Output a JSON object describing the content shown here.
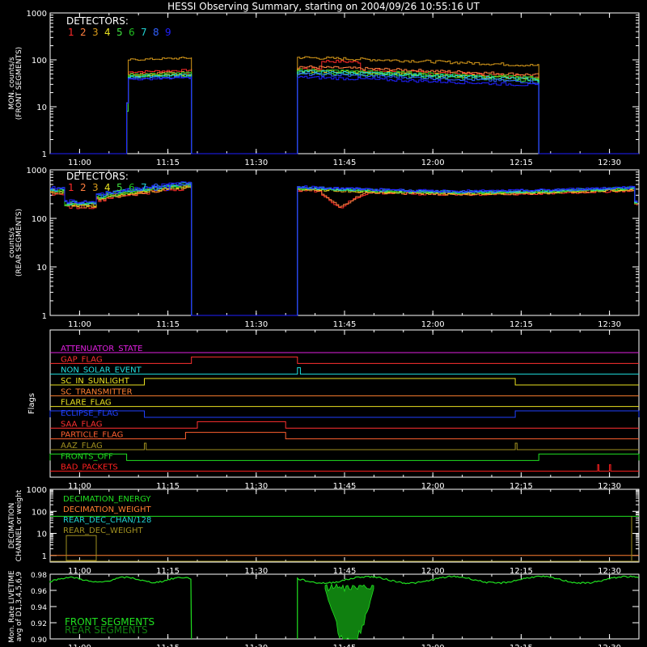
{
  "title": "HESSI Observing Summary, starting on 2004/09/26 10:55:16 UT",
  "colors": {
    "frame": "#ffffff",
    "detectors": [
      "#ff2a2a",
      "#ff7f3f",
      "#d89a1a",
      "#e8e020",
      "#40e040",
      "#20c020",
      "#20d0d0",
      "#3060ff",
      "#2020ff"
    ]
  },
  "chart_data": [
    {
      "type": "line",
      "panel": "front_rates",
      "ylabel_lines": [
        "MON. counts/s",
        "(FRONT SEGMENTS)"
      ],
      "y_log": true,
      "ylim": [
        1,
        1000
      ],
      "y_ticks": [
        "1",
        "10",
        "100",
        "1000"
      ],
      "x_ticks": [
        "11:00",
        "11:15",
        "11:30",
        "11:45",
        "12:00",
        "12:15",
        "12:30"
      ],
      "xlim_minutes_after_10:55": [
        0,
        100
      ],
      "legend_title": "DETECTORS:",
      "legend_items": [
        "1",
        "2",
        "3",
        "4",
        "5",
        "6",
        "7",
        "8",
        "9"
      ],
      "data_segments": [
        {
          "start": "11:08",
          "end": "11:19",
          "level_range": [
            40,
            110
          ]
        },
        {
          "start": "11:37",
          "end": "12:18",
          "level_range": [
            25,
            120
          ]
        }
      ]
    },
    {
      "type": "line",
      "panel": "rear_rates",
      "ylabel_lines": [
        "counts/s",
        "(REAR SEGMENTS)"
      ],
      "y_log": true,
      "ylim": [
        1,
        1000
      ],
      "y_ticks": [
        "1",
        "10",
        "100",
        "1000"
      ],
      "x_ticks": [
        "11:00",
        "11:15",
        "11:30",
        "11:45",
        "12:00",
        "12:15",
        "12:30"
      ],
      "legend_title": "DETECTORS:",
      "legend_items": [
        "1",
        "2",
        "3",
        "4",
        "5",
        "6",
        "7",
        "8",
        "9"
      ],
      "data_segments": [
        {
          "start": "10:55",
          "end": "11:19",
          "level_range": [
            180,
            600
          ]
        },
        {
          "start": "11:37",
          "end": "12:35",
          "level_range": [
            150,
            450
          ]
        }
      ]
    },
    {
      "type": "table",
      "panel": "flags",
      "ylabel": "Flags",
      "x_ticks": [
        "11:00",
        "11:15",
        "11:30",
        "11:45",
        "12:00",
        "12:15",
        "12:30"
      ],
      "flags": [
        {
          "label": "ATTENUATOR_STATE",
          "color": "#e020e0",
          "on_intervals": []
        },
        {
          "label": "GAP_FLAG",
          "color": "#ff3030",
          "on_intervals": [
            [
              "11:19",
              "11:37"
            ]
          ]
        },
        {
          "label": "NON_SOLAR_EVENT",
          "color": "#20e0e0",
          "on_intervals": [
            [
              "11:37",
              "11:37.5"
            ]
          ]
        },
        {
          "label": "SC_IN_SUNLIGHT",
          "color": "#e8e020",
          "on_intervals": [
            [
              "11:11",
              "12:14"
            ]
          ]
        },
        {
          "label": "SC_TRANSMITTER",
          "color": "#ff8030",
          "on_intervals": []
        },
        {
          "label": "FLARE_FLAG",
          "color": "#e8e020",
          "on_intervals": []
        },
        {
          "label": "ECLIPSE_FLAG",
          "color": "#2040ff",
          "on_intervals": [
            [
              "10:55",
              "11:11"
            ],
            [
              "12:14",
              "12:35"
            ]
          ]
        },
        {
          "label": "SAA_FLAG",
          "color": "#ff3030",
          "on_intervals": [
            [
              "11:20",
              "11:35"
            ]
          ]
        },
        {
          "label": "PARTICLE_FLAG",
          "color": "#ff6030",
          "on_intervals": [
            [
              "11:18",
              "11:35"
            ]
          ]
        },
        {
          "label": "AAZ_FLAG",
          "color": "#a09020",
          "on_intervals": [
            [
              "11:11",
              "11:11.3"
            ],
            [
              "12:14",
              "12:14.3"
            ]
          ]
        },
        {
          "label": "FRONTS_OFF",
          "color": "#20e020",
          "on_intervals": [
            [
              "10:55",
              "11:08"
            ],
            [
              "12:18",
              "12:35"
            ]
          ]
        },
        {
          "label": "BAD_PACKETS",
          "color": "#ff2020",
          "on_intervals": [
            [
              "12:28",
              "12:28.2"
            ],
            [
              "12:30",
              "12:30.2"
            ]
          ]
        }
      ]
    },
    {
      "type": "line",
      "panel": "decimation",
      "ylabel_lines": [
        "DECIMATION",
        "CHANNEL or weight"
      ],
      "y_log": true,
      "ylim": [
        0.5,
        1000
      ],
      "y_ticks": [
        "1",
        "10",
        "100",
        "1000"
      ],
      "x_ticks": [
        "11:00",
        "11:15",
        "11:30",
        "11:45",
        "12:00",
        "12:15",
        "12:30"
      ],
      "series": [
        {
          "name": "DECIMATION_ENERGY",
          "color": "#20e020",
          "value": 60
        },
        {
          "name": "DECIMATION_WEIGHT",
          "color": "#ff8030",
          "value": 1
        },
        {
          "name": "REAR_DEC_CHAN/128",
          "color": "#20d0d0",
          "value": 0.5
        },
        {
          "name": "REAR_DEC_WEIGHT",
          "color": "#a09020",
          "value": 0.5
        }
      ]
    },
    {
      "type": "area",
      "panel": "livetime",
      "ylabel_lines": [
        "Mon. Rate LIVETIME",
        "avg of D1,3,4,5,6,9"
      ],
      "ylim": [
        0.9,
        0.98
      ],
      "y_ticks": [
        "0.90",
        "0.92",
        "0.94",
        "0.96",
        "0.98"
      ],
      "x_ticks": [
        "11:00",
        "11:15",
        "11:30",
        "11:45",
        "12:00",
        "12:15",
        "12:30"
      ],
      "series": [
        {
          "name": "FRONT SEGMENTS",
          "color": "#20e020"
        },
        {
          "name": "REAR SEGMENTS",
          "color": "#108010"
        }
      ],
      "notes": "livetime ~0.975 during data, dips to ~0.90 around 11:44-11:48"
    }
  ]
}
